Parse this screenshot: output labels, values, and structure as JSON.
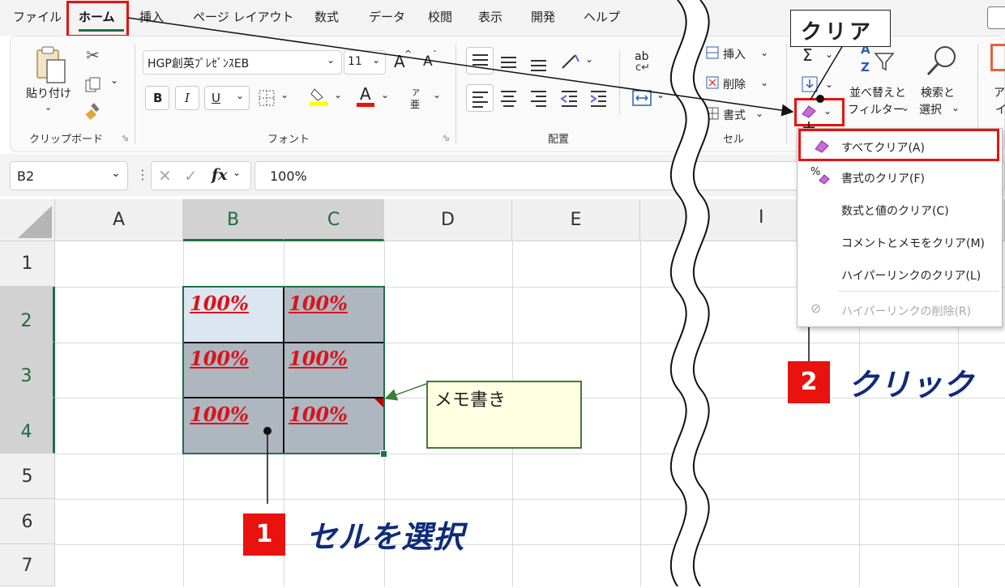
{
  "menu": {
    "tabs": [
      "ファイル",
      "ホーム",
      "挿入",
      "ページ レイアウト",
      "数式",
      "データ",
      "校閲",
      "表示",
      "開発",
      "ヘルプ"
    ]
  },
  "ribbon": {
    "clipboard": {
      "paste_label": "貼り付け",
      "group_label": "クリップボード"
    },
    "font": {
      "font_name": "HGP創英ﾌﾟﾚｾﾞﾝｽEB",
      "font_size": "11",
      "grow": "A",
      "shrink": "A",
      "bold": "B",
      "italic": "I",
      "underline": "U",
      "font_color": "A",
      "phonetic_top": "ア",
      "phonetic_bottom": "亜",
      "group_label": "フォント"
    },
    "alignment": {
      "wrap": "ab",
      "group_label": "配置"
    },
    "cells": {
      "insert": "挿入",
      "delete": "削除",
      "format": "書式",
      "group_label": "セル"
    },
    "editing": {
      "sum": "Σ",
      "sort_line1": "並べ替えと",
      "sort_line2": "フィルター",
      "find_line1": "検索と",
      "find_line2": "選択",
      "az_a": "A",
      "az_z": "Z"
    },
    "cutoff_line1": "ア",
    "cutoff_line2": "イ"
  },
  "formula_bar": {
    "name_box": "B2",
    "fx": "fx",
    "value": "100%"
  },
  "sheet": {
    "columns": [
      "A",
      "B",
      "C",
      "D",
      "E",
      "I"
    ],
    "rows": [
      "1",
      "2",
      "3",
      "4",
      "5",
      "6",
      "7"
    ],
    "cells": {
      "B2": "100%",
      "C2": "100%",
      "B3": "100%",
      "C3": "100%",
      "B4": "100%",
      "C4": "100%"
    },
    "memo": "メモ書き"
  },
  "clear_dropdown": {
    "items": [
      "すべてクリア(A)",
      "書式のクリア(F)",
      "数式と値のクリア(C)",
      "コメントとメモをクリア(M)",
      "ハイパーリンクのクリア(L)",
      "ハイパーリンクの削除(R)"
    ]
  },
  "callouts": {
    "clear_label": "クリア",
    "step1_num": "1",
    "step1_text": "セルを選択",
    "step2_num": "2",
    "step2_text": "クリック"
  },
  "colors": {
    "accent_green": "#1e7145",
    "highlight_red": "#e8120f",
    "value_red": "#d8141c",
    "step_text_blue": "#0f2b7a",
    "memo_bg": "#ffffe1"
  }
}
